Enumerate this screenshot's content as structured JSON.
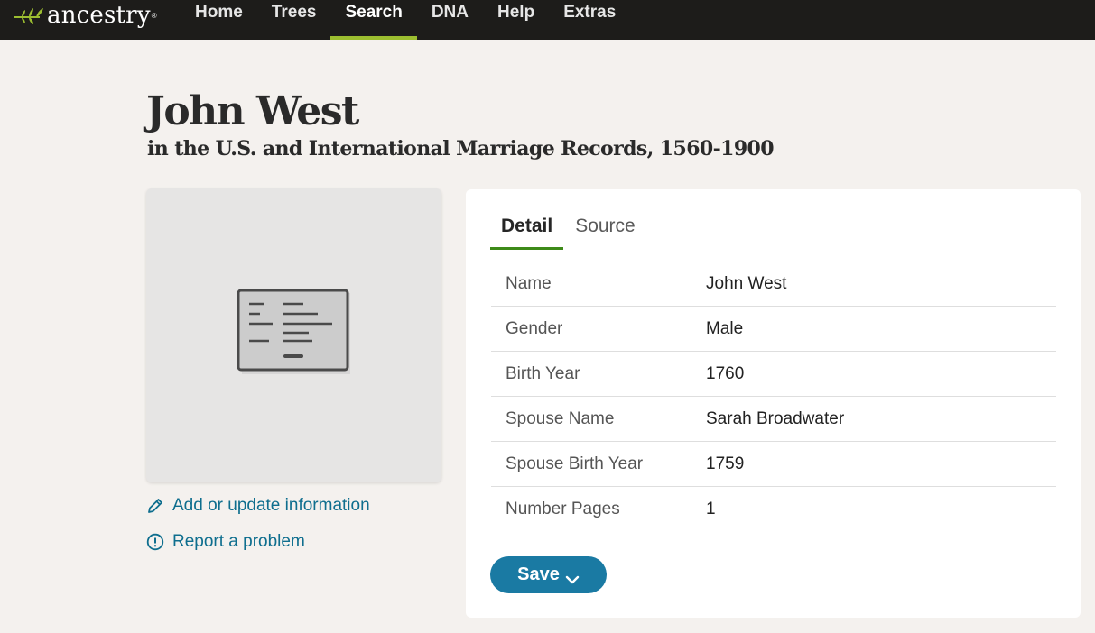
{
  "nav": {
    "logo_text": "ancestry",
    "logo_tm": "®",
    "items": [
      {
        "label": "Home"
      },
      {
        "label": "Trees"
      },
      {
        "label": "Search"
      },
      {
        "label": "DNA"
      },
      {
        "label": "Help"
      },
      {
        "label": "Extras"
      }
    ],
    "active_item": "Search"
  },
  "record": {
    "name": "John West",
    "collection": "in the U.S. and International Marriage Records, 1560-1900"
  },
  "side_links": {
    "update": "Add or update information",
    "report": "Report a problem"
  },
  "panel": {
    "tabs": [
      {
        "label": "Detail"
      },
      {
        "label": "Source"
      }
    ],
    "active_tab": "Detail",
    "fields": [
      {
        "label": "Name",
        "value": "John West"
      },
      {
        "label": "Gender",
        "value": "Male"
      },
      {
        "label": "Birth Year",
        "value": "1760"
      },
      {
        "label": "Spouse Name",
        "value": "Sarah Broadwater"
      },
      {
        "label": "Spouse Birth Year",
        "value": "1759"
      },
      {
        "label": "Number Pages",
        "value": "1"
      }
    ],
    "save_label": "Save"
  },
  "colors": {
    "nav_bg": "#1d1c1a",
    "nav_active_underline": "#9cbe30",
    "page_bg": "#f4f1ee",
    "link": "#0e6e8e",
    "tab_underline": "#3d8a18",
    "save_button": "#1a7aa3"
  },
  "icons": {
    "logo": "leaf-icon",
    "record_placeholder": "record-card-icon",
    "update": "pencil-icon",
    "report": "alert-circle-icon",
    "save_dropdown": "chevron-down-icon"
  }
}
